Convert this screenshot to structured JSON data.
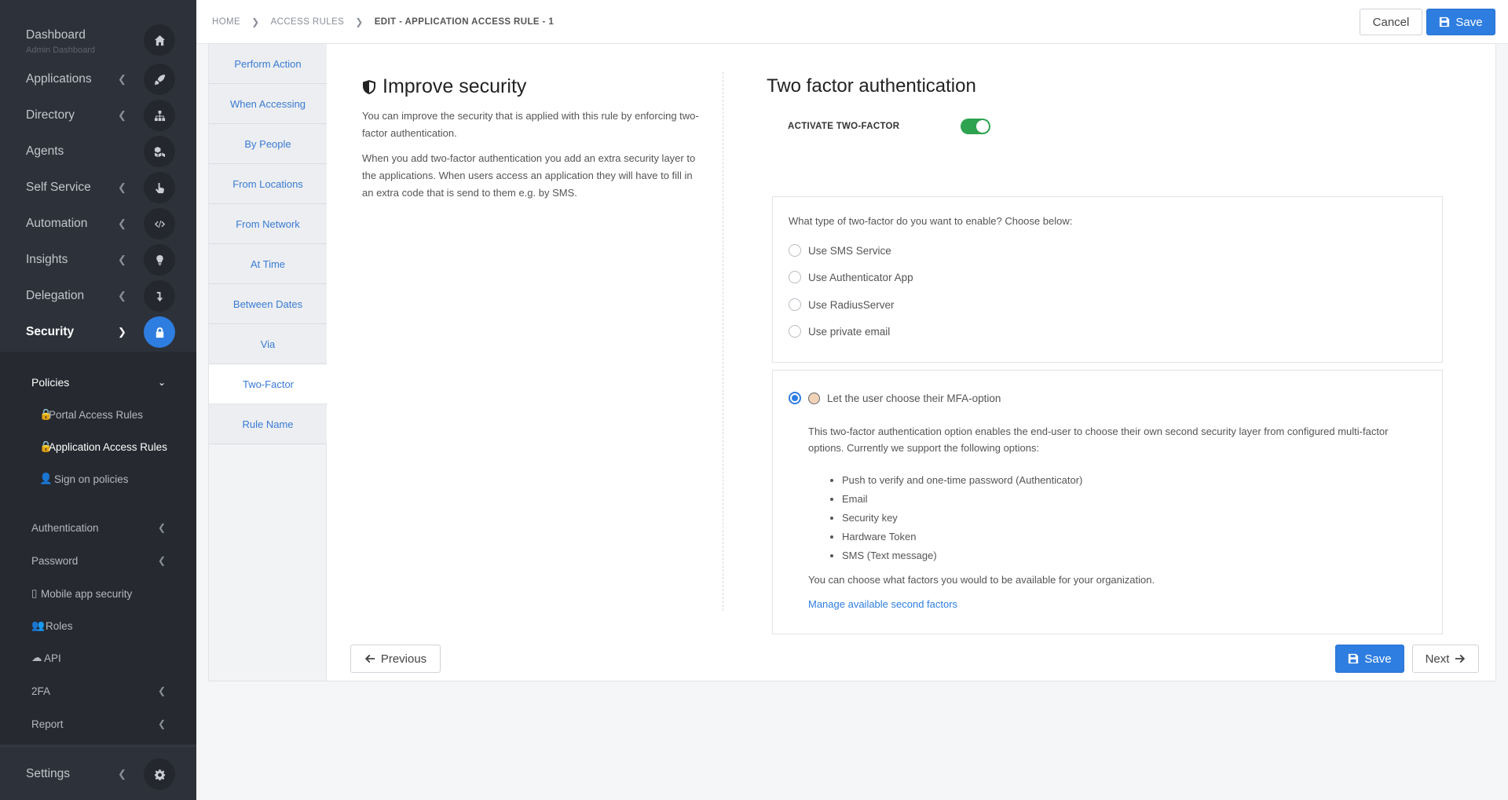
{
  "sidebar": {
    "dashboard": {
      "label": "Dashboard",
      "sub": "Admin Dashboard"
    },
    "items": [
      {
        "label": "Applications",
        "icon": "rocket-icon"
      },
      {
        "label": "Directory",
        "icon": "sitemap-icon"
      },
      {
        "label": "Agents",
        "icon": "cubes-icon"
      },
      {
        "label": "Self Service",
        "icon": "hand-pointer-icon"
      },
      {
        "label": "Automation",
        "icon": "code-icon"
      },
      {
        "label": "Insights",
        "icon": "lightbulb-icon"
      },
      {
        "label": "Delegation",
        "icon": "level-down-icon"
      },
      {
        "label": "Security",
        "icon": "lock-icon"
      }
    ],
    "submenu": {
      "policies": "Policies",
      "portal_access_rules": "Portal Access Rules",
      "application_access_rules": "Application Access Rules",
      "sign_on_policies": "Sign on policies",
      "authentication": "Authentication",
      "password": "Password",
      "mobile_app_security": "Mobile app security",
      "roles": "Roles",
      "api": "API",
      "twofa": "2FA",
      "report": "Report"
    },
    "settings": "Settings"
  },
  "breadcrumb": {
    "home": "HOME",
    "access_rules": "ACCESS RULES",
    "current": "EDIT - APPLICATION ACCESS RULE - 1"
  },
  "header": {
    "cancel": "Cancel",
    "save": "Save"
  },
  "steps": [
    "Perform Action",
    "When Accessing",
    "By People",
    "From Locations",
    "From Network",
    "At Time",
    "Between Dates",
    "Via",
    "Two-Factor",
    "Rule Name"
  ],
  "active_step": "Two-Factor",
  "improve": {
    "title": "Improve security",
    "p1": "You can improve the security that is applied with this rule by enforcing two-factor authentication.",
    "p2": "When you add two-factor authentication you add an extra security layer to the applications. When users access an application they will have to fill in an extra code that is send to them e.g. by SMS."
  },
  "twofactor": {
    "title": "Two factor authentication",
    "activate_label": "ACTIVATE TWO-FACTOR",
    "activated": true,
    "question": "What type of two-factor do you want to enable? Choose below:",
    "options": [
      "Use SMS Service",
      "Use Authenticator App",
      "Use RadiusServer",
      "Use private email"
    ],
    "mfa_option": "Let the user choose their MFA-option",
    "mfa_selected": true,
    "mfa_desc": "This two-factor authentication option enables the end-user to choose their own second security layer from configured multi-factor options. Currently we support the following options:",
    "mfa_list": [
      "Push to verify and one-time password (Authenticator)",
      "Email",
      "Security key",
      "Hardware Token",
      "SMS (Text message)"
    ],
    "mfa_note": "You can choose what factors you would to be available for your organization.",
    "manage_link": "Manage available second factors"
  },
  "footer": {
    "previous": "Previous",
    "save": "Save",
    "next": "Next"
  },
  "colors": {
    "sidebar_bg": "#2d3139",
    "accent": "#2e7de1",
    "toggle_on": "#2fa24f",
    "link": "#3a7bd5"
  }
}
